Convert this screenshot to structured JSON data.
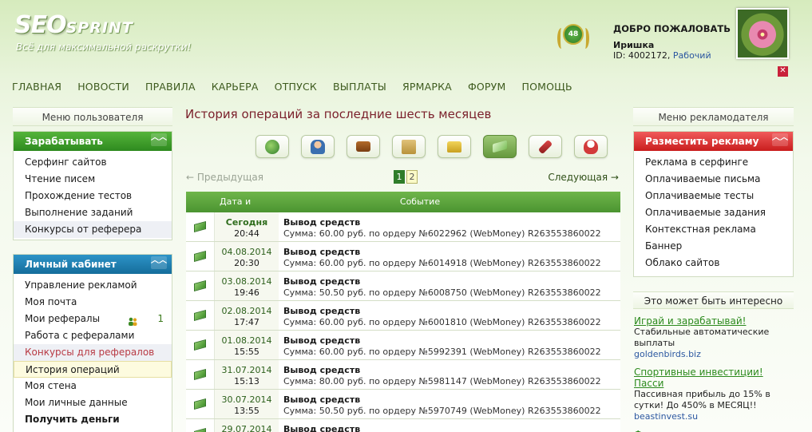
{
  "header": {
    "logo_main": "SEO",
    "logo_sub": "SPRINT",
    "tagline": "Всё для максимальной раскрутки!",
    "badge_value": "48",
    "welcome": "ДОБРО ПОЖАЛОВАТЬ",
    "username": "Иришка",
    "id_label": "ID: 4002172,",
    "status": "Рабочий"
  },
  "nav": [
    "ГЛАВНАЯ",
    "НОВОСТИ",
    "ПРАВИЛА",
    "КАРЬЕРА",
    "ОТПУСК",
    "ВЫПЛАТЫ",
    "ЯРМАРКА",
    "ФОРУМ",
    "ПОМОЩЬ"
  ],
  "left": {
    "menu_title": "Меню пользователя",
    "earn": {
      "title": "Зарабатывать",
      "items": [
        "Серфинг сайтов",
        "Чтение писем",
        "Прохождение тестов",
        "Выполнение заданий",
        "Конкурсы от реферера"
      ]
    },
    "cabinet": {
      "title": "Личный кабинет",
      "items": [
        "Управление рекламой",
        "Моя почта",
        "Мои рефералы",
        "Работа с рефералами",
        "Конкурсы для рефералов",
        "История операций",
        "Моя стена",
        "Мои личные данные",
        "Получить деньги"
      ],
      "referrals_count": "1"
    }
  },
  "main": {
    "title": "История операций за последние шесть месяцев",
    "prev": "← Предыдущая",
    "next": "Следующая →",
    "pages": [
      "1",
      "2"
    ],
    "columns": [
      "Дата и время",
      "Событие"
    ],
    "rows": [
      {
        "date": "Сегодня",
        "time": "20:44",
        "title": "Вывод средств",
        "desc": "Сумма: 60.00 руб. по ордеру №6022962 (WebMoney) R263553860022"
      },
      {
        "date": "04.08.2014",
        "time": "20:30",
        "title": "Вывод средств",
        "desc": "Сумма: 60.00 руб. по ордеру №6014918 (WebMoney) R263553860022"
      },
      {
        "date": "03.08.2014",
        "time": "19:46",
        "title": "Вывод средств",
        "desc": "Сумма: 50.50 руб. по ордеру №6008750 (WebMoney) R263553860022"
      },
      {
        "date": "02.08.2014",
        "time": "17:47",
        "title": "Вывод средств",
        "desc": "Сумма: 60.00 руб. по ордеру №6001810 (WebMoney) R263553860022"
      },
      {
        "date": "01.08.2014",
        "time": "15:55",
        "title": "Вывод средств",
        "desc": "Сумма: 60.00 руб. по ордеру №5992391 (WebMoney) R263553860022"
      },
      {
        "date": "31.07.2014",
        "time": "15:13",
        "title": "Вывод средств",
        "desc": "Сумма: 80.00 руб. по ордеру №5981147 (WebMoney) R263553860022"
      },
      {
        "date": "30.07.2014",
        "time": "13:55",
        "title": "Вывод средств",
        "desc": "Сумма: 50.50 руб. по ордеру №5970749 (WebMoney) R263553860022"
      },
      {
        "date": "29.07.2014",
        "time": "",
        "title": "Вывод средств",
        "desc": ""
      }
    ]
  },
  "right": {
    "menu_title": "Меню рекламодателя",
    "ads": {
      "title": "Разместить рекламу",
      "items": [
        "Реклама в серфинге",
        "Оплачиваемые письма",
        "Оплачиваемые тесты",
        "Оплачиваемые задания",
        "Контекстная реклама",
        "Баннер",
        "Облако сайтов"
      ]
    },
    "interest_title": "Это может быть интересно",
    "promos": [
      {
        "title": "Играй и зарабатывай!",
        "desc": "Стабильные автоматические выплаты",
        "url": "goldenbirds.biz"
      },
      {
        "title": "Спортивные инвестиции! Пасси",
        "desc": "Пассивная прибыль до 15% в сутки! До 450% в МЕСЯЦ!!",
        "url": "beastinvest.su"
      },
      {
        "title": "Феноменальная система раскру",
        "desc": "",
        "url": ""
      }
    ]
  }
}
